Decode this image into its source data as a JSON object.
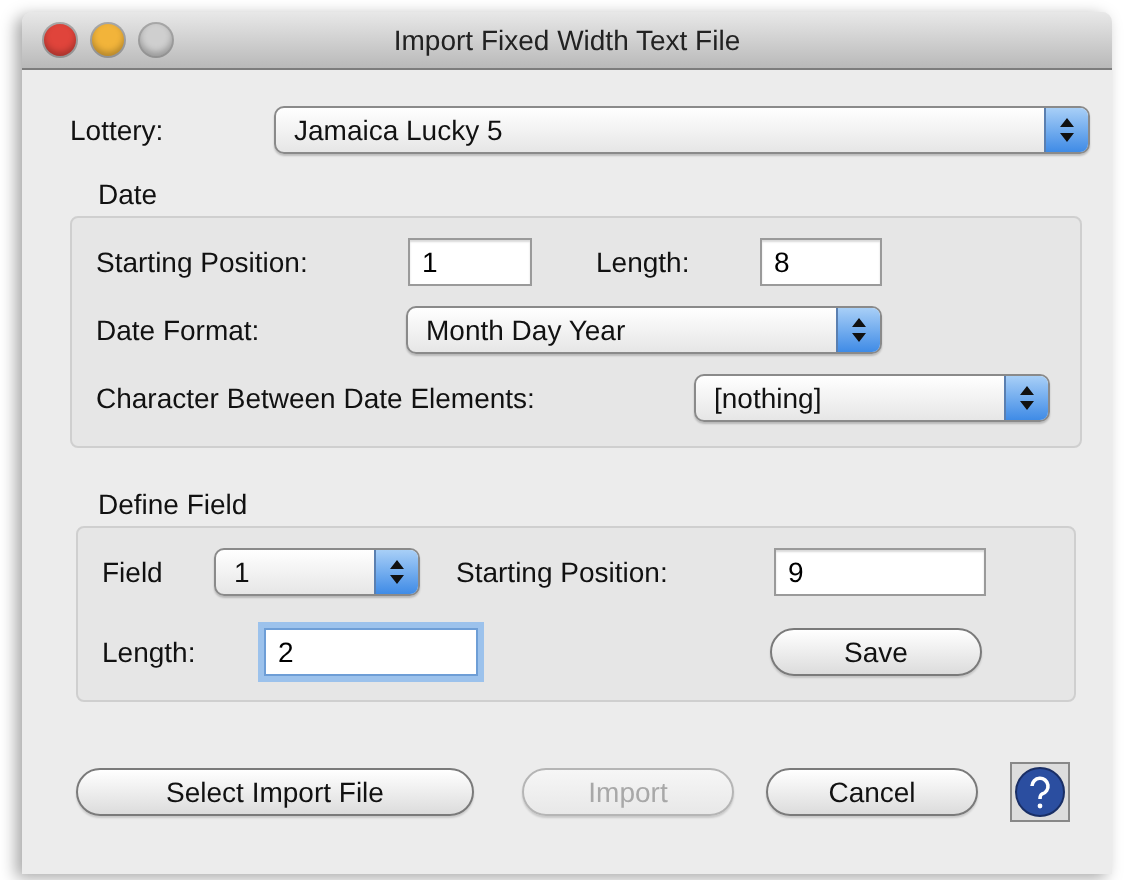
{
  "window": {
    "title": "Import Fixed Width Text File"
  },
  "lottery": {
    "label": "Lottery:",
    "value": "Jamaica Lucky 5"
  },
  "date": {
    "legend": "Date",
    "starting_position": {
      "label": "Starting Position:",
      "value": "1",
      "focused": false
    },
    "length": {
      "label": "Length:",
      "value": "8",
      "focused": false
    },
    "date_format": {
      "label": "Date Format:",
      "value": "Month Day Year"
    },
    "separator": {
      "label": "Character Between Date Elements:",
      "value": "[nothing]"
    }
  },
  "define_field": {
    "legend": "Define Field",
    "field": {
      "label": "Field",
      "value": "1"
    },
    "starting_position": {
      "label": "Starting Position:",
      "value": "9",
      "focused": false
    },
    "length": {
      "label": "Length:",
      "value": "2",
      "focused": true
    },
    "save": {
      "label": "Save",
      "disabled": false
    }
  },
  "buttons": [
    {
      "label": "Select Import File",
      "disabled": false
    },
    {
      "label": "Import",
      "disabled": true
    },
    {
      "label": "Cancel",
      "disabled": false
    }
  ]
}
